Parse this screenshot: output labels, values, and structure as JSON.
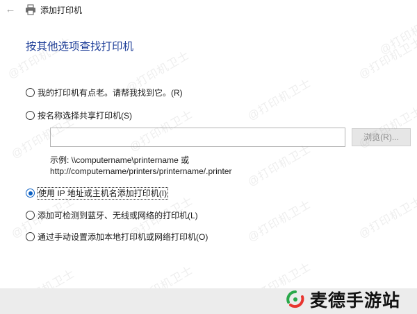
{
  "window": {
    "title": "添加打印机",
    "back_icon": "back-arrow-icon",
    "app_icon": "printer-icon"
  },
  "heading": "按其他选项查找打印机",
  "options": [
    {
      "label": "我的打印机有点老。请帮我找到它。(R)",
      "selected": false
    },
    {
      "label": "按名称选择共享打印机(S)",
      "selected": false
    },
    {
      "label": "使用 IP 地址或主机名添加打印机(I)",
      "selected": true
    },
    {
      "label": "添加可检测到蓝牙、无线或网络的打印机(L)",
      "selected": false
    },
    {
      "label": "通过手动设置添加本地打印机或网络打印机(O)",
      "selected": false
    }
  ],
  "share_name": {
    "value": "",
    "browse_label": "浏览(R)...",
    "example_line1": "示例: \\\\computername\\printername 或",
    "example_line2": "http://computername/printers/printername/.printer"
  },
  "watermark": "@打印机卫士",
  "brand": {
    "name": "麦德手游站",
    "colors": {
      "green": "#2aa84a",
      "red": "#e8352f"
    }
  },
  "colors": {
    "heading": "#1f3f99",
    "radio_selected": "#0a5fc2"
  }
}
